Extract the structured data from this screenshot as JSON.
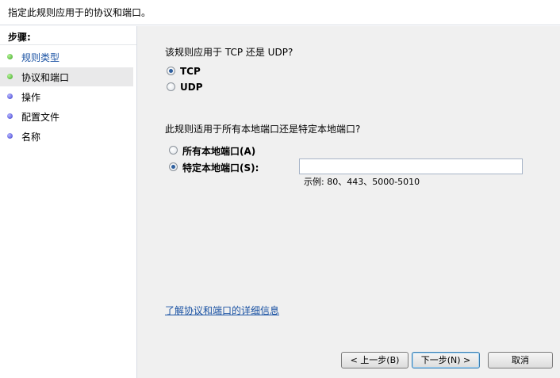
{
  "header": {
    "title": "指定此规则应用于的协议和端口。"
  },
  "sidebar": {
    "heading": "步骤:",
    "items": [
      {
        "label": "规则类型",
        "state": "done"
      },
      {
        "label": "协议和端口",
        "state": "current"
      },
      {
        "label": "操作",
        "state": "pending"
      },
      {
        "label": "配置文件",
        "state": "pending"
      },
      {
        "label": "名称",
        "state": "pending"
      }
    ]
  },
  "main": {
    "protocol_question": "该规则应用于 TCP 还是 UDP?",
    "protocol_options": [
      {
        "label": "TCP",
        "checked": true
      },
      {
        "label": "UDP",
        "checked": false
      }
    ],
    "port_question": "此规则适用于所有本地端口还是特定本地端口?",
    "port_options": [
      {
        "label": "所有本地端口(A)",
        "checked": false
      },
      {
        "label": "特定本地端口(S):",
        "checked": true
      }
    ],
    "port_input_value": "",
    "example": "示例: 80、443、5000-5010",
    "help_link": "了解协议和端口的详细信息"
  },
  "buttons": {
    "back": "< 上一步(B)",
    "next": "下一步(N) >",
    "cancel": "取消"
  },
  "colors": {
    "link": "#1a52a3",
    "panel_bg": "#f0f0f0",
    "done_dot": "#3aa423",
    "pending_dot": "#3c3ccf"
  }
}
